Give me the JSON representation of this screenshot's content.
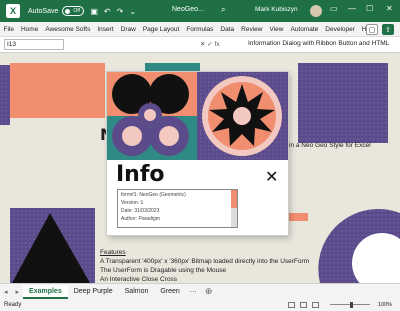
{
  "titlebar": {
    "logo": "X",
    "autosave_label": "AutoSave",
    "autosave_state": "Off",
    "file_name": "NeoGeo...",
    "user_name": "Mark Kubiszyn",
    "ctrl_ribbon": "▭",
    "ctrl_min": "—",
    "ctrl_max": "☐",
    "ctrl_close": "✕"
  },
  "menu": {
    "items": [
      "File",
      "Home",
      "Awesome Softs",
      "Insert",
      "Draw",
      "Page Layout",
      "Formulas",
      "Data",
      "Review",
      "View",
      "Automate",
      "Developer",
      "Help"
    ],
    "comments_icon": "comment-icon",
    "share_icon": "share-icon"
  },
  "formula_bar": {
    "name_box": "I13",
    "fx_label": "fx",
    "formula": "Information Dialog with Ribbon Button and HTML"
  },
  "sheet": {
    "behind_title_fragment": "N",
    "behind_text_right": "in a Neo Geo Style for Excel",
    "features_heading": "Features",
    "feature_lines": [
      "A Transparent '400px' x '360px' Bitmap loaded directly into the UserForm",
      "The UserForm is Dragable using the Mouse",
      "An Interactive Close Cross"
    ]
  },
  "userform": {
    "title": "Info",
    "close_glyph": "✕",
    "lines": [
      "form#1: NeoGeo (Geometric)",
      "Version: 1",
      "Date: 31/03/2023",
      "Author: Paradigm"
    ]
  },
  "tabs": {
    "nav_prev": "◂",
    "nav_next": "▸",
    "sheets": [
      "Examples",
      "Deep Purple",
      "Salmon",
      "Green"
    ],
    "add": "⊕",
    "overflow": "⋯"
  },
  "status": {
    "ready": "Ready",
    "zoom": "100%"
  },
  "colors": {
    "excel_green": "#1f7145",
    "salmon": "#f08e6f",
    "purple": "#5b4b8a",
    "teal": "#2f8a86",
    "cream": "#e9e6dc",
    "pink": "#f2c8c0"
  }
}
